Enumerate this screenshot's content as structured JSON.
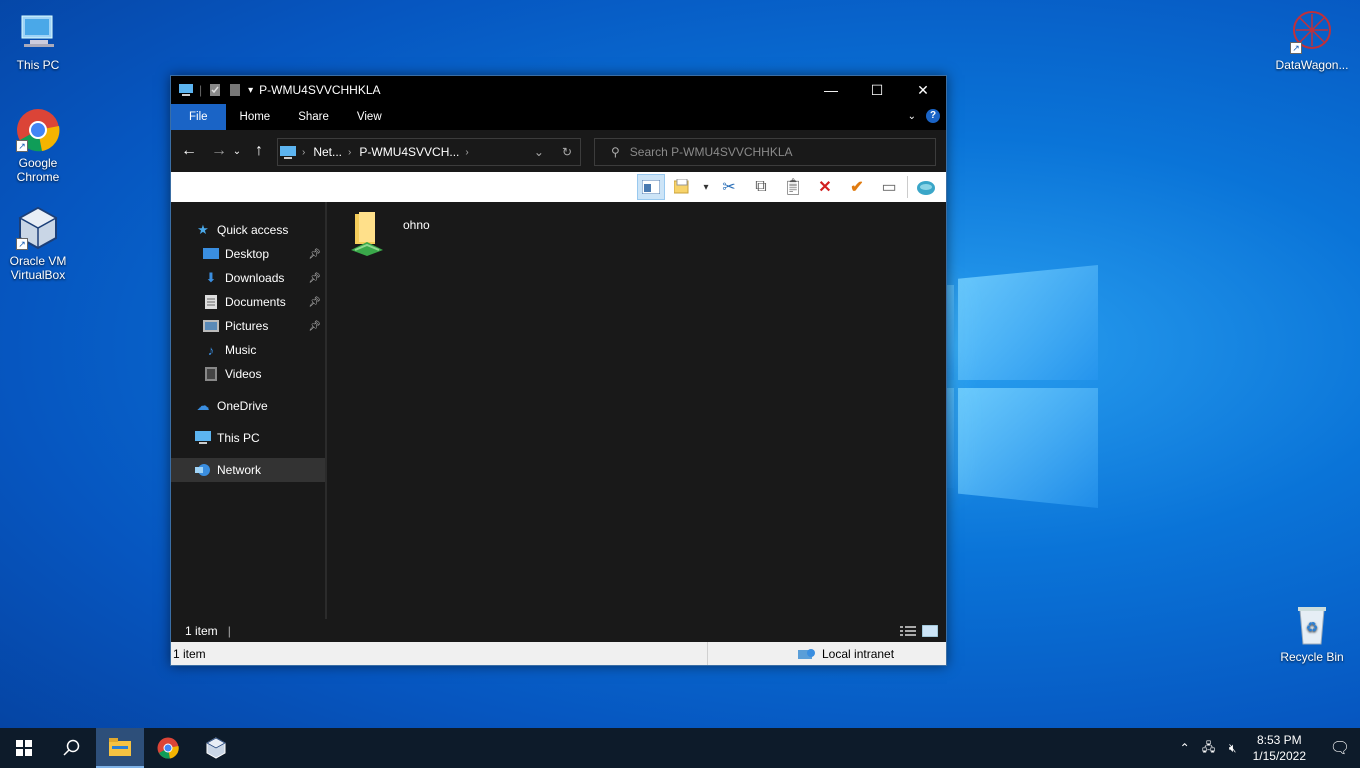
{
  "desktop": {
    "icons": [
      {
        "label": "This PC"
      },
      {
        "label": "Google Chrome"
      },
      {
        "label": "Oracle VM VirtualBox"
      },
      {
        "label": "DataWagon..."
      },
      {
        "label": "Recycle Bin"
      }
    ]
  },
  "window": {
    "title": "P-WMU4SVVCHHKLA",
    "tabs": [
      "File",
      "Home",
      "Share",
      "View"
    ],
    "help_label": "?",
    "address": {
      "segments": [
        "Net...",
        "P-WMU4SVVCH..."
      ]
    },
    "search": {
      "placeholder": "Search P-WMU4SVVCHHKLA"
    },
    "sidebar": {
      "items": [
        {
          "label": "Quick access",
          "icon": "star-icon"
        },
        {
          "label": "Desktop",
          "icon": "desktop-icon",
          "pinned": true
        },
        {
          "label": "Downloads",
          "icon": "download-icon",
          "pinned": true
        },
        {
          "label": "Documents",
          "icon": "document-icon",
          "pinned": true
        },
        {
          "label": "Pictures",
          "icon": "pictures-icon",
          "pinned": true
        },
        {
          "label": "Music",
          "icon": "music-icon"
        },
        {
          "label": "Videos",
          "icon": "videos-icon"
        },
        {
          "label": "OneDrive",
          "icon": "cloud-icon"
        },
        {
          "label": "This PC",
          "icon": "computer-icon"
        },
        {
          "label": "Network",
          "icon": "network-icon",
          "selected": true
        }
      ]
    },
    "content": {
      "items": [
        {
          "label": "ohno",
          "icon": "shared-folder-icon"
        }
      ]
    },
    "status": {
      "count": "1 item",
      "count_bottom": "1 item",
      "zone": "Local intranet"
    }
  },
  "taskbar": {
    "clock_time": "8:53 PM",
    "clock_date": "1/15/2022"
  },
  "colors": {
    "accent": "#1a64c6",
    "window_bg": "#191919",
    "taskbar_bg": "#0d1b2a"
  }
}
